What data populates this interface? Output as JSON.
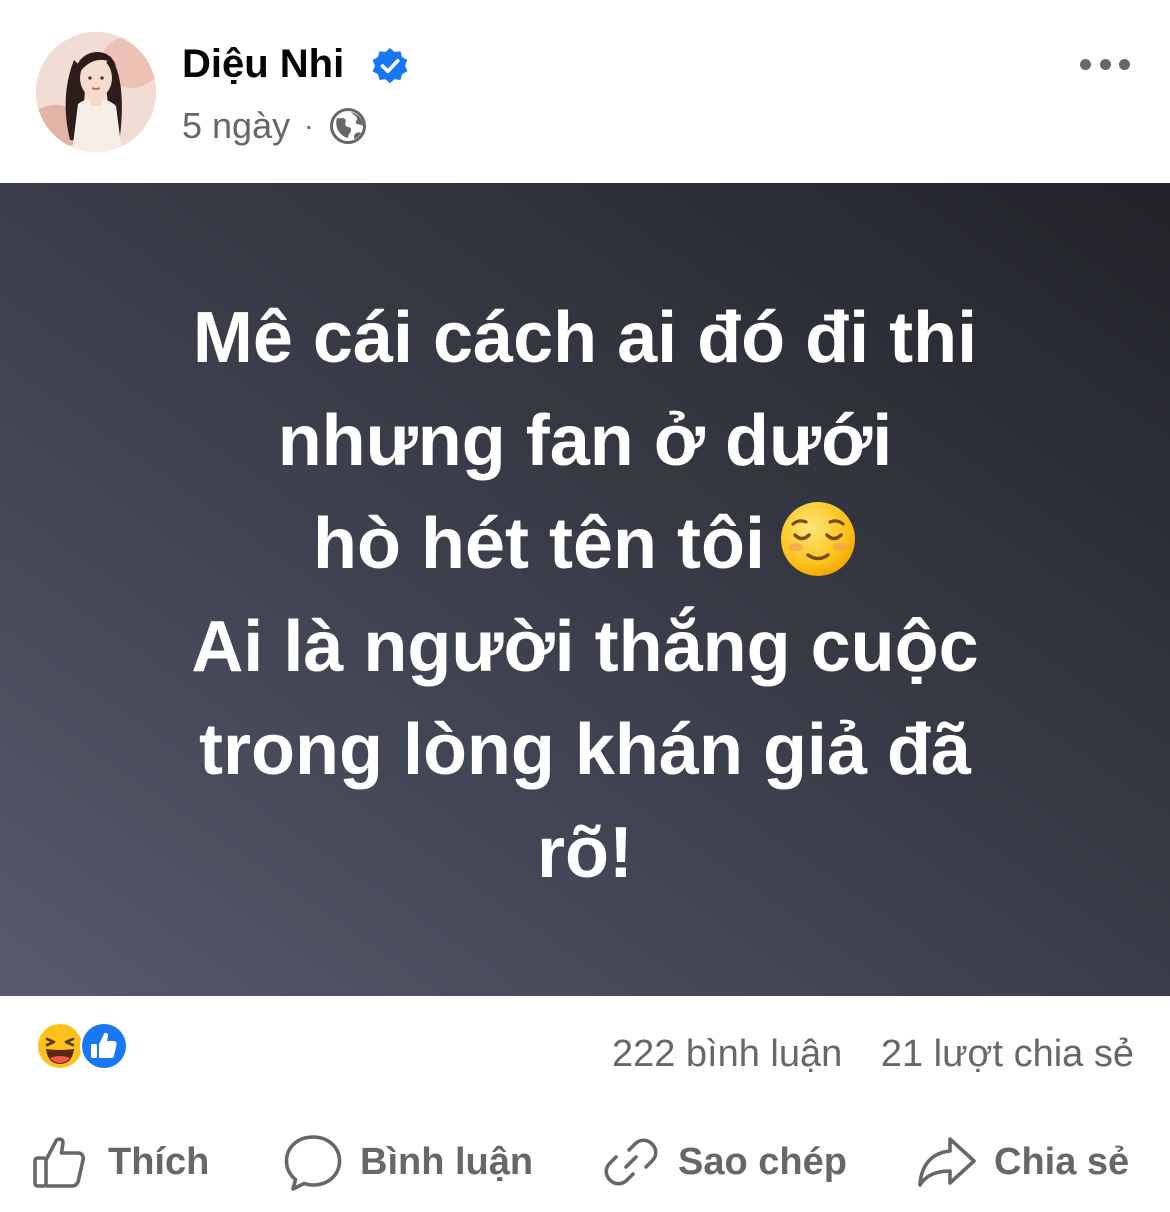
{
  "post": {
    "author": "Diệu Nhi",
    "time": "5 ngày",
    "separator": "·",
    "status_lines": [
      "Mê cái cách ai đó đi thi",
      "nhưng fan ở dưới",
      "hò hét tên tôi",
      "Ai là người thắng cuộc",
      "trong lòng khán giả đã",
      "rõ!"
    ],
    "colors": {
      "background_gradient": [
        "#565a6b",
        "#222329"
      ],
      "verified": "#1877f2",
      "meta_text": "#65676b"
    }
  },
  "stats": {
    "comments": "222 bình luận",
    "shares": "21 lượt chia sẻ"
  },
  "actions": {
    "like": "Thích",
    "comment": "Bình luận",
    "copy": "Sao chép",
    "share": "Chia sẻ"
  },
  "icons": {
    "verified": "verified-badge-icon",
    "audience": "globe-icon",
    "more": "more-options-icon",
    "reaction_1": "haha-reaction-icon",
    "reaction_2": "like-reaction-icon",
    "status_emoji": "relieved-face-emoji"
  }
}
